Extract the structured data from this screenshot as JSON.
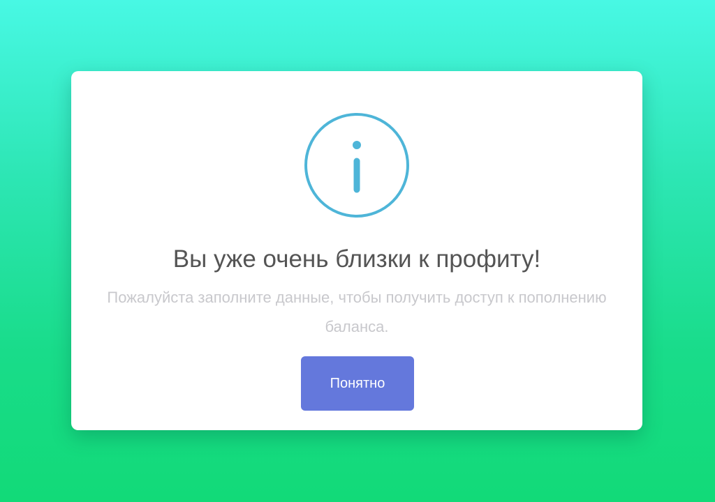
{
  "modal": {
    "icon": "info-icon",
    "title": "Вы уже очень близки к профиту!",
    "message": "Пожалуйста заполните данные, чтобы получить доступ к пополнению баланса.",
    "confirm_label": "Понятно"
  },
  "colors": {
    "background_top": "#48f8e4",
    "background_bottom": "#12da78",
    "icon_accent": "#4eb5d8",
    "button": "#6478dc"
  }
}
